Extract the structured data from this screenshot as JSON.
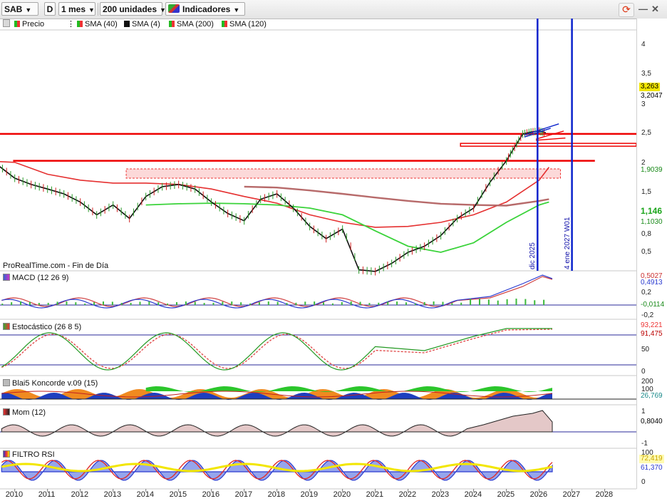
{
  "toolbar": {
    "symbol": "SAB",
    "d_label": "D",
    "period": "1 mes",
    "units": "200 unidades",
    "indicators": "Indicadores"
  },
  "legend": {
    "price": "Precio",
    "sma40": "SMA (40)",
    "sma4": "SMA (4)",
    "sma200": "SMA (200)",
    "sma120": "SMA (120)"
  },
  "colors": {
    "sma40": "#e53030",
    "sma4": "#111111",
    "sma200": "#b76a6a",
    "sma120": "#3ad33a",
    "hline": "#ee0000",
    "vline": "#0a22cc",
    "accent_yellow": "#f2e600"
  },
  "source_note": "ProRealTime.com - Fin de Día",
  "vertical_lines": [
    {
      "label": "dic 2025"
    },
    {
      "label": "4 ene 2027 W01"
    }
  ],
  "panels": {
    "macd": {
      "label": "MACD (12 26 9)",
      "ticks": [
        "0,5027",
        "0,4913",
        "0,2",
        "-0,0114",
        "-0,2"
      ]
    },
    "stoch": {
      "label": "Estocástico (26 8 5)",
      "ticks": [
        "93,221",
        "91,475",
        "50",
        "0"
      ]
    },
    "koncorde": {
      "label": "Blai5 Koncorde v.09 (15)",
      "ticks": [
        "200",
        "100",
        "26,769"
      ]
    },
    "mom": {
      "label": "Mom (12)",
      "ticks": [
        "1",
        "0,8040",
        "-1"
      ]
    },
    "rsi": {
      "label": "FILTRO RSI",
      "ticks": [
        "100",
        "72,419",
        "61,370",
        "0"
      ]
    }
  },
  "price_axis": {
    "ticks": [
      "4",
      "3,5",
      "3",
      "2,5",
      "2",
      "1,5",
      "0,8",
      "0,5"
    ],
    "tags": [
      "3,263",
      "3,2047",
      "1,9039",
      "1,146",
      "1,1030"
    ]
  },
  "chart_data": {
    "type": "line",
    "x_axis_labels": [
      "2010",
      "2011",
      "2012",
      "2013",
      "2014",
      "2015",
      "2016",
      "2017",
      "2018",
      "2019",
      "2020",
      "2021",
      "2022",
      "2023",
      "2024",
      "2025",
      "2026",
      "2027",
      "2028"
    ],
    "y_scale": "log",
    "ylim": [
      0.3,
      4.5
    ],
    "series": [
      {
        "name": "Precio",
        "x": [
          2009.0,
          2009.5,
          2010.0,
          2010.5,
          2011.0,
          2011.5,
          2012.0,
          2012.5,
          2013.0,
          2013.5,
          2014.0,
          2014.5,
          2015.0,
          2015.5,
          2016.0,
          2016.5,
          2017.0,
          2017.5,
          2018.0,
          2018.5,
          2019.0,
          2019.5,
          2020.0,
          2020.5,
          2021.0,
          2021.5,
          2022.0,
          2022.5,
          2023.0,
          2023.5,
          2024.0,
          2024.5,
          2025.0,
          2025.25,
          2025.5,
          2025.75,
          2026.0,
          2026.2
        ],
        "values": [
          1.6,
          1.95,
          1.6,
          1.45,
          1.35,
          1.25,
          1.1,
          0.9,
          1.05,
          0.85,
          1.2,
          1.4,
          1.45,
          1.35,
          1.1,
          0.92,
          0.82,
          1.15,
          1.25,
          1.0,
          0.75,
          0.62,
          0.72,
          0.38,
          0.37,
          0.42,
          0.5,
          0.55,
          0.65,
          0.85,
          1.0,
          1.5,
          2.1,
          2.6,
          3.2,
          3.3,
          3.35,
          3.26
        ]
      },
      {
        "name": "SMA (40)",
        "x": [
          2009.0,
          2010.0,
          2011.0,
          2012.0,
          2013.0,
          2014.0,
          2015.0,
          2016.0,
          2017.0,
          2018.0,
          2019.0,
          2020.0,
          2021.0,
          2022.0,
          2023.0,
          2024.0,
          2025.0,
          2026.0,
          2026.3
        ],
        "values": [
          2.1,
          2.05,
          1.7,
          1.55,
          1.48,
          1.48,
          1.45,
          1.35,
          1.2,
          1.08,
          0.9,
          0.8,
          0.74,
          0.75,
          0.8,
          0.9,
          1.1,
          1.55,
          1.9
        ]
      },
      {
        "name": "SMA (200)",
        "x": [
          2017.0,
          2018.0,
          2019.0,
          2020.0,
          2021.0,
          2022.0,
          2023.0,
          2024.0,
          2025.0,
          2026.0,
          2026.3
        ],
        "values": [
          1.4,
          1.38,
          1.32,
          1.25,
          1.18,
          1.12,
          1.07,
          1.05,
          1.04,
          1.12,
          1.15
        ]
      },
      {
        "name": "SMA (120)",
        "x": [
          2014.0,
          2015.0,
          2016.0,
          2017.0,
          2018.0,
          2019.0,
          2020.0,
          2021.0,
          2022.0,
          2023.0,
          2024.0,
          2025.0,
          2026.0,
          2026.3
        ],
        "values": [
          1.05,
          1.07,
          1.08,
          1.07,
          1.05,
          1.0,
          0.9,
          0.7,
          0.55,
          0.5,
          0.58,
          0.8,
          1.05,
          1.1
        ]
      }
    ],
    "horizontal_levels": [
      3.2047,
      2.7,
      2.1
    ],
    "zone": [
      1.6,
      1.85
    ]
  }
}
